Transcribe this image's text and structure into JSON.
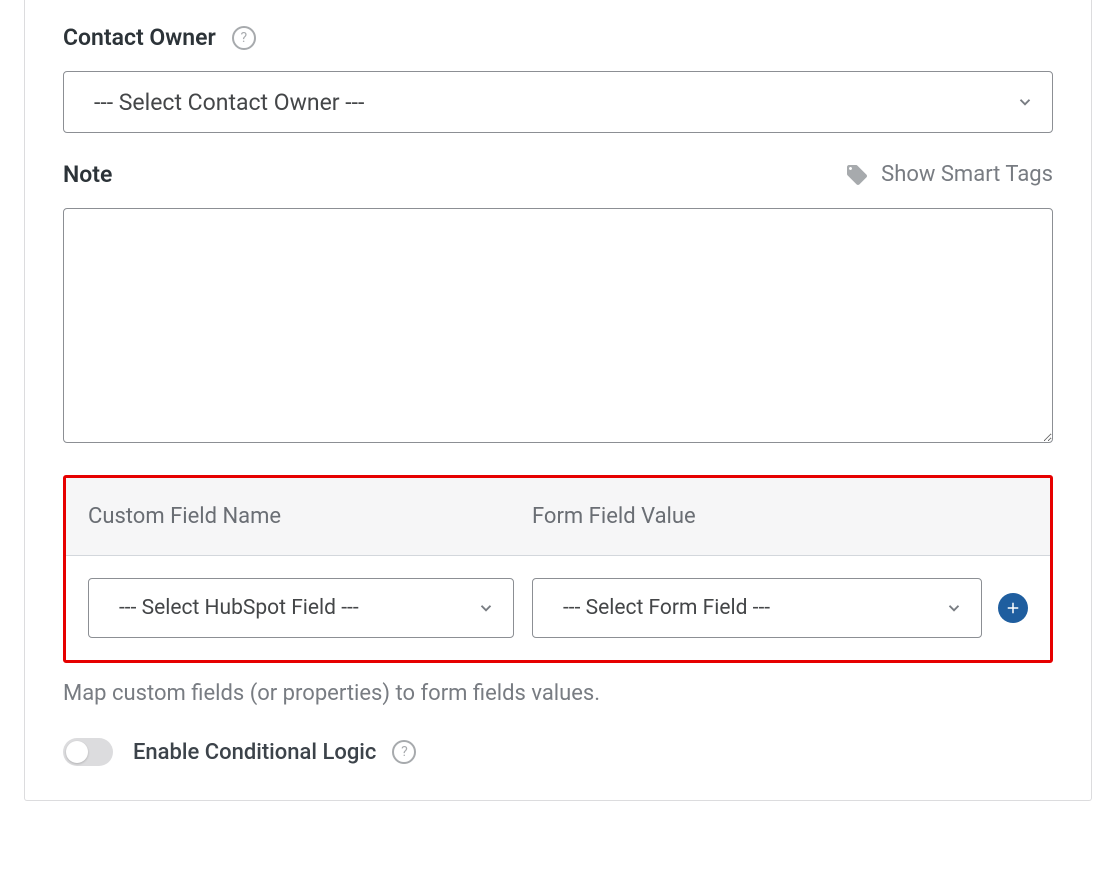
{
  "contactOwner": {
    "label": "Contact Owner",
    "selected": "--- Select Contact Owner ---"
  },
  "note": {
    "label": "Note",
    "smartTagsLabel": "Show Smart Tags",
    "value": ""
  },
  "customFields": {
    "headerCol1": "Custom Field Name",
    "headerCol2": "Form Field Value",
    "row": {
      "hubspotField": "--- Select HubSpot Field ---",
      "formField": "--- Select Form Field ---"
    },
    "helpText": "Map custom fields (or properties) to form fields values."
  },
  "conditionalLogic": {
    "label": "Enable Conditional Logic",
    "enabled": false
  }
}
